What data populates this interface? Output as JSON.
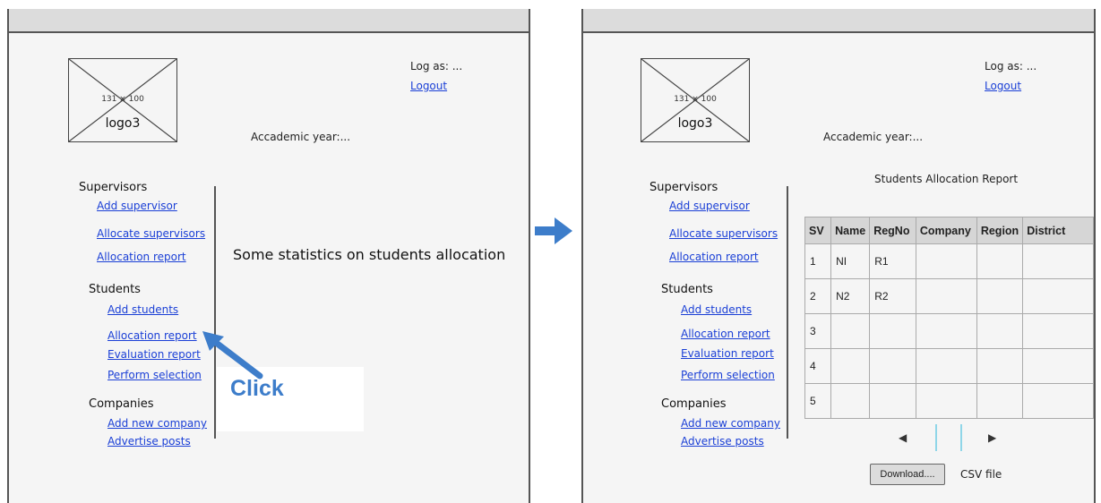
{
  "left": {
    "logo": {
      "dim": "131 × 100",
      "name": "logo3"
    },
    "log_as": "Log as: ...",
    "logout": "Logout",
    "academic_year": "Accademic year:...",
    "nav": {
      "supervisors": "Supervisors",
      "add_supervisor": "Add supervisor",
      "allocate_supervisors": "Allocate supervisors",
      "sup_allocation_report": "Allocation report",
      "students": "Students",
      "add_students": "Add students",
      "stu_allocation_report": "Allocation report",
      "evaluation_report": "Evaluation report",
      "perform_selection": "Perform selection",
      "companies": "Companies",
      "add_new_company": "Add new company",
      "advertise_posts": "Advertise posts"
    },
    "stats_text": "Some statistics on students allocation",
    "click_label": "Click"
  },
  "right": {
    "logo": {
      "dim": "131 × 100",
      "name": "logo3"
    },
    "log_as": "Log as: ...",
    "logout": "Logout",
    "academic_year": "Accademic year:...",
    "nav": {
      "supervisors": "Supervisors",
      "add_supervisor": "Add supervisor",
      "allocate_supervisors": "Allocate supervisors",
      "sup_allocation_report": "Allocation report",
      "students": "Students",
      "add_students": "Add students",
      "stu_allocation_report": "Allocation report",
      "evaluation_report": "Evaluation report",
      "perform_selection": "Perform selection",
      "companies": "Companies",
      "add_new_company": "Add new company",
      "advertise_posts": "Advertise posts"
    },
    "report_title": "Students Allocation Report",
    "table": {
      "headers": [
        "SV",
        "Name",
        "RegNo",
        "Company",
        "Region",
        "District"
      ],
      "rows": [
        [
          "1",
          "NI",
          "R1",
          "",
          "",
          ""
        ],
        [
          "2",
          "N2",
          "R2",
          "",
          "",
          ""
        ],
        [
          "3",
          "",
          "",
          "",
          "",
          ""
        ],
        [
          "4",
          "",
          "",
          "",
          "",
          ""
        ],
        [
          "5",
          "",
          "",
          "",
          "",
          ""
        ]
      ]
    },
    "pager": {
      "prev": "◀",
      "next": "▶"
    },
    "download_label": "Download....",
    "csv_label": "CSV file"
  },
  "colors": {
    "accent_arrow": "#3d7dca",
    "link": "#1a3fd6"
  }
}
